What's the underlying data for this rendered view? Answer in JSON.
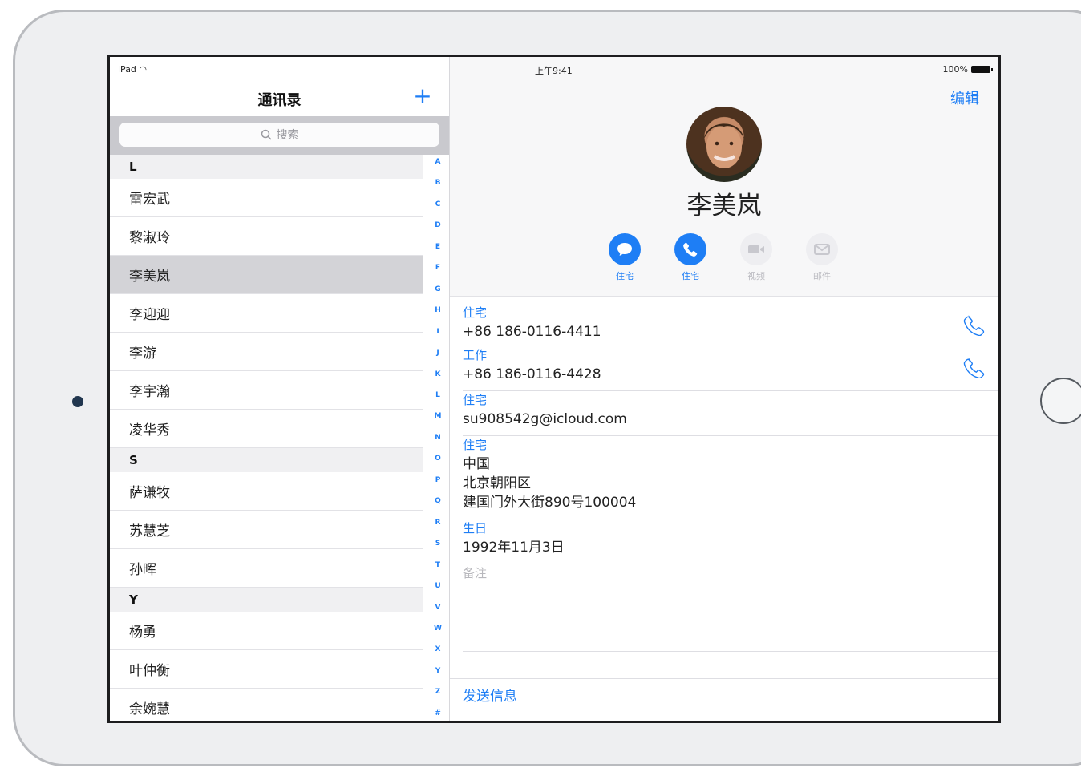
{
  "status": {
    "device": "iPad",
    "time": "上午9:41",
    "battery": "100%"
  },
  "contacts": {
    "title": "通讯录",
    "search_placeholder": "搜索",
    "index_letters": [
      "A",
      "B",
      "C",
      "D",
      "E",
      "F",
      "G",
      "H",
      "I",
      "J",
      "K",
      "L",
      "M",
      "N",
      "O",
      "P",
      "Q",
      "R",
      "S",
      "T",
      "U",
      "V",
      "W",
      "X",
      "Y",
      "Z",
      "#"
    ],
    "sections": [
      {
        "letter": "L",
        "items": [
          "雷宏武",
          "黎淑玲",
          "李美岚",
          "李迎迎",
          "李游",
          "李宇瀚",
          "凌华秀"
        ]
      },
      {
        "letter": "S",
        "items": [
          "萨谦牧",
          "苏慧芝",
          "孙晖"
        ]
      },
      {
        "letter": "Y",
        "items": [
          "杨勇",
          "叶仲衡",
          "余婉慧"
        ]
      }
    ],
    "selected": "李美岚"
  },
  "detail": {
    "edit": "编辑",
    "name": "李美岚",
    "actions": [
      {
        "label": "住宅",
        "icon": "message-icon",
        "enabled": true
      },
      {
        "label": "住宅",
        "icon": "phone-icon",
        "enabled": true
      },
      {
        "label": "视频",
        "icon": "video-icon",
        "enabled": false
      },
      {
        "label": "邮件",
        "icon": "mail-icon",
        "enabled": false
      }
    ],
    "home_phone": {
      "label": "住宅",
      "value": "+86 186-0116-4411"
    },
    "work_phone": {
      "label": "工作",
      "value": "+86 186-0116-4428"
    },
    "email": {
      "label": "住宅",
      "value": "su908542g@icloud.com"
    },
    "address": {
      "label": "住宅",
      "country": "中国",
      "city": "北京朝阳区",
      "street": "建国门外大街890号100004"
    },
    "birthday": {
      "label": "生日",
      "value": "1992年11月3日"
    },
    "notes": "备注",
    "send_message": "发送信息"
  },
  "colors": {
    "accent": "#1E7EF5",
    "selected_row": "#D3D3D7",
    "device": "#EEEFF1"
  }
}
